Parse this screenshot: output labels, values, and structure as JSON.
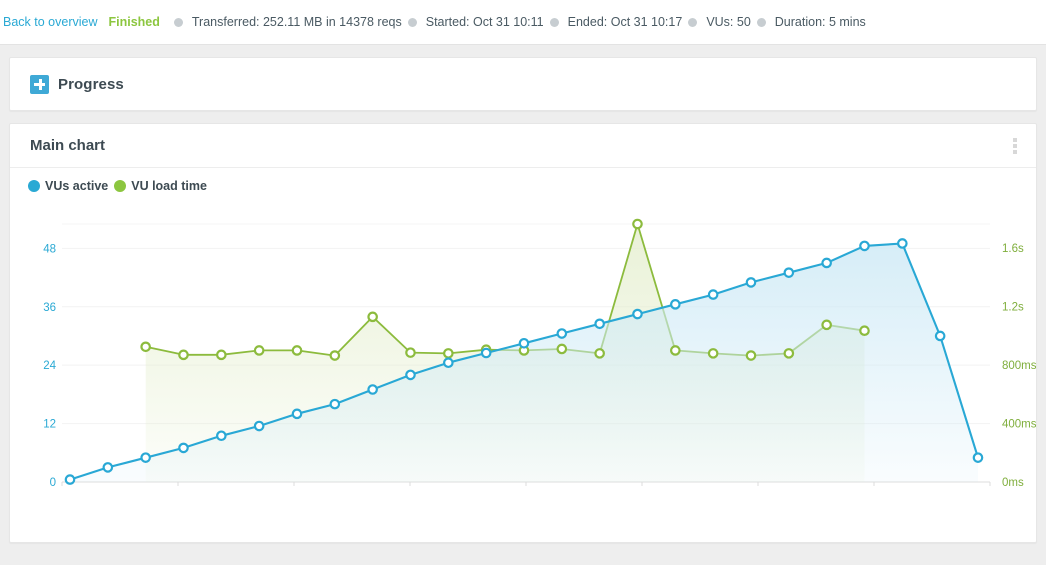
{
  "topbar": {
    "back_link": "Back to overview",
    "status": "Finished",
    "stats": [
      "Transferred: 252.11 MB in 14378 reqs",
      "Started: Oct 31 10:11",
      "Ended: Oct 31 10:17",
      "VUs: 50",
      "Duration: 5 mins"
    ]
  },
  "progress_panel": {
    "title": "Progress",
    "icon": "plus-square-icon"
  },
  "chart_panel": {
    "title": "Main chart",
    "menu_icon": "kebab-menu-icon",
    "legend": [
      {
        "label": "VUs active",
        "color": "#2aa9d4"
      },
      {
        "label": "VU load time",
        "color": "#8cc63f"
      }
    ]
  },
  "colors": {
    "blue": "#29a8d5",
    "green": "#8cbb3d",
    "blue_fill": "#cfeaf6",
    "green_fill": "#e4eecd",
    "panel_bg": "#ffffff",
    "page_bg": "#eeeeee",
    "grid": "#f2f2f2",
    "axis": "#dcdcdc"
  },
  "chart_data": {
    "type": "line",
    "title": "Main chart",
    "xlabel": "",
    "grid": true,
    "legend_position": "top-left",
    "x_axis": {
      "ticks_only": true,
      "tick_count": 9
    },
    "y_axis_left": {
      "label": "VUs active",
      "ticks": [
        0,
        12,
        24,
        36,
        48
      ],
      "tick_labels": [
        "0",
        "12",
        "24",
        "36",
        "48"
      ],
      "ylim": [
        0,
        53
      ],
      "color": "#2aa9d4"
    },
    "y_axis_right": {
      "label": "VU load time",
      "ticks": [
        0,
        400,
        800,
        1200,
        1600
      ],
      "tick_labels": [
        "0ms",
        "400ms",
        "800ms",
        "1.2s",
        "1.6s"
      ],
      "ylim": [
        0,
        1765
      ],
      "unit": "ms",
      "color": "#7fae3c"
    },
    "series": [
      {
        "name": "VUs active",
        "axis": "left",
        "color": "#29a8d5",
        "fill": "#cfeaf6",
        "marker": "circle-open",
        "x": [
          0,
          1,
          2,
          3,
          4,
          5,
          6,
          7,
          8,
          9,
          10,
          11,
          12,
          13,
          14,
          15,
          16,
          17,
          18,
          19,
          20,
          21,
          22,
          23
        ],
        "values": [
          0.5,
          3,
          5,
          7,
          9.5,
          11.5,
          14,
          16,
          19,
          22,
          24.5,
          26.5,
          28.5,
          30.5,
          32.5,
          34.5,
          36.5,
          38.5,
          41,
          43,
          45,
          48.5,
          49,
          30
        ]
      },
      {
        "name": "VU load time",
        "axis": "right",
        "color": "#8cbb3d",
        "fill": "#e4eecd",
        "marker": "circle-open",
        "x": [
          2,
          3,
          4,
          5,
          6,
          7,
          8,
          9,
          10,
          11,
          12,
          13,
          14,
          15,
          16,
          17,
          18,
          19,
          20,
          21
        ],
        "values": [
          925,
          870,
          870,
          900,
          900,
          865,
          1130,
          885,
          880,
          905,
          900,
          910,
          880,
          1765,
          900,
          880,
          865,
          880,
          1075,
          1035
        ]
      },
      {
        "name": "VUs active (tail)",
        "axis": "left",
        "color": "#29a8d5",
        "marker": "circle-open",
        "x": [
          23,
          24
        ],
        "values": [
          30,
          5
        ]
      }
    ]
  }
}
